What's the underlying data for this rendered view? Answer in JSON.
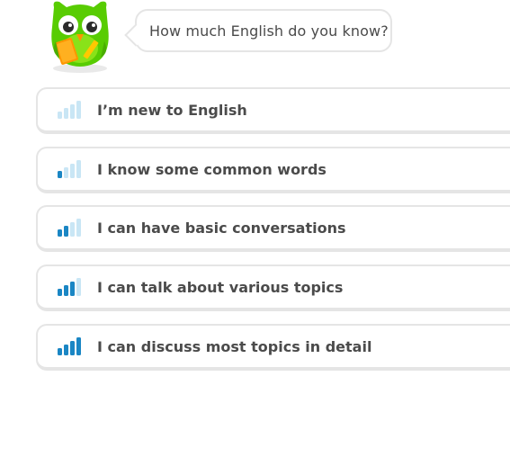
{
  "prompt": {
    "question": "How much English do you know?"
  },
  "colors": {
    "bar_active": "#1a86c4",
    "bar_inactive": "#c9e6f5",
    "text": "#4b4b4b",
    "border": "#e5e5e5"
  },
  "options": [
    {
      "label": "I’m new to English",
      "level": 0
    },
    {
      "label": "I know some common words",
      "level": 1
    },
    {
      "label": "I can have basic conversations",
      "level": 2
    },
    {
      "label": "I can talk about various topics",
      "level": 3
    },
    {
      "label": "I can discuss most topics in detail",
      "level": 4
    }
  ]
}
